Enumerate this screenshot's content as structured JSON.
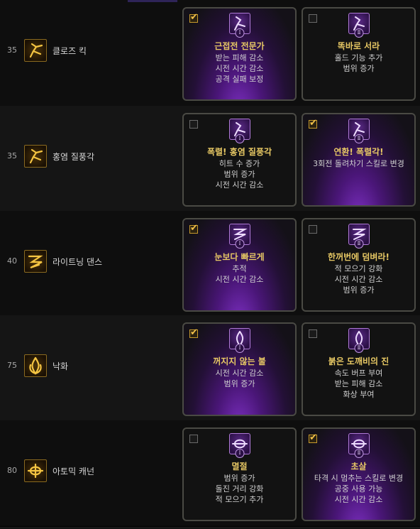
{
  "rows": [
    {
      "level": "35",
      "skill": "클로즈 킥",
      "icon": "kick-icon",
      "options": [
        {
          "numeral": "Ⅰ",
          "selected": true,
          "title": "근접전 전문가",
          "lines": [
            "받는 피해 감소",
            "시전 시간 감소",
            "공격 실패 보정"
          ]
        },
        {
          "numeral": "Ⅱ",
          "selected": false,
          "title": "똑바로 서라",
          "lines": [
            "홀드 기능 추가",
            "범위 증가"
          ]
        }
      ]
    },
    {
      "level": "35",
      "skill": "홍염 질풍각",
      "icon": "flame-kick-icon",
      "options": [
        {
          "numeral": "Ⅰ",
          "selected": false,
          "title": "폭렬! 홍염 질풍각",
          "lines": [
            "히트 수 증가",
            "범위 증가",
            "시전 시간 감소"
          ]
        },
        {
          "numeral": "Ⅱ",
          "selected": true,
          "title": "연환! 폭렬각!",
          "lines": [
            "3회전 돌려차기 스킬로 변경"
          ]
        }
      ]
    },
    {
      "level": "40",
      "skill": "라이트닝 댄스",
      "icon": "lightning-dance-icon",
      "options": [
        {
          "numeral": "Ⅰ",
          "selected": true,
          "title": "눈보다 빠르게",
          "lines": [
            "추적",
            "시전 시간 감소"
          ]
        },
        {
          "numeral": "Ⅱ",
          "selected": false,
          "title": "한꺼번에 덤벼라!",
          "lines": [
            "적 모으기 강화",
            "시전 시간 감소",
            "범위 증가"
          ]
        }
      ]
    },
    {
      "level": "75",
      "skill": "낙화",
      "icon": "falling-flower-icon",
      "options": [
        {
          "numeral": "Ⅰ",
          "selected": true,
          "title": "꺼지지 않는 불",
          "lines": [
            "시전 시간 감소",
            "범위 증가"
          ]
        },
        {
          "numeral": "Ⅱ",
          "selected": false,
          "title": "붉은 도깨비의 진",
          "lines": [
            "속도 버프 부여",
            "받는 피해 감소",
            "화상 부여"
          ]
        }
      ]
    },
    {
      "level": "80",
      "skill": "아토믹 캐넌",
      "icon": "atomic-cannon-icon",
      "options": [
        {
          "numeral": "Ⅰ",
          "selected": false,
          "title": "멸절",
          "lines": [
            "범위 증가",
            "돌진 거리 강화",
            "적 모으기 추가"
          ]
        },
        {
          "numeral": "Ⅱ",
          "selected": true,
          "title": "초살",
          "lines": [
            "타격 시 멈추는 스킬로 변경",
            "공중 사용 가능",
            "시전 시간 감소"
          ]
        }
      ]
    }
  ]
}
